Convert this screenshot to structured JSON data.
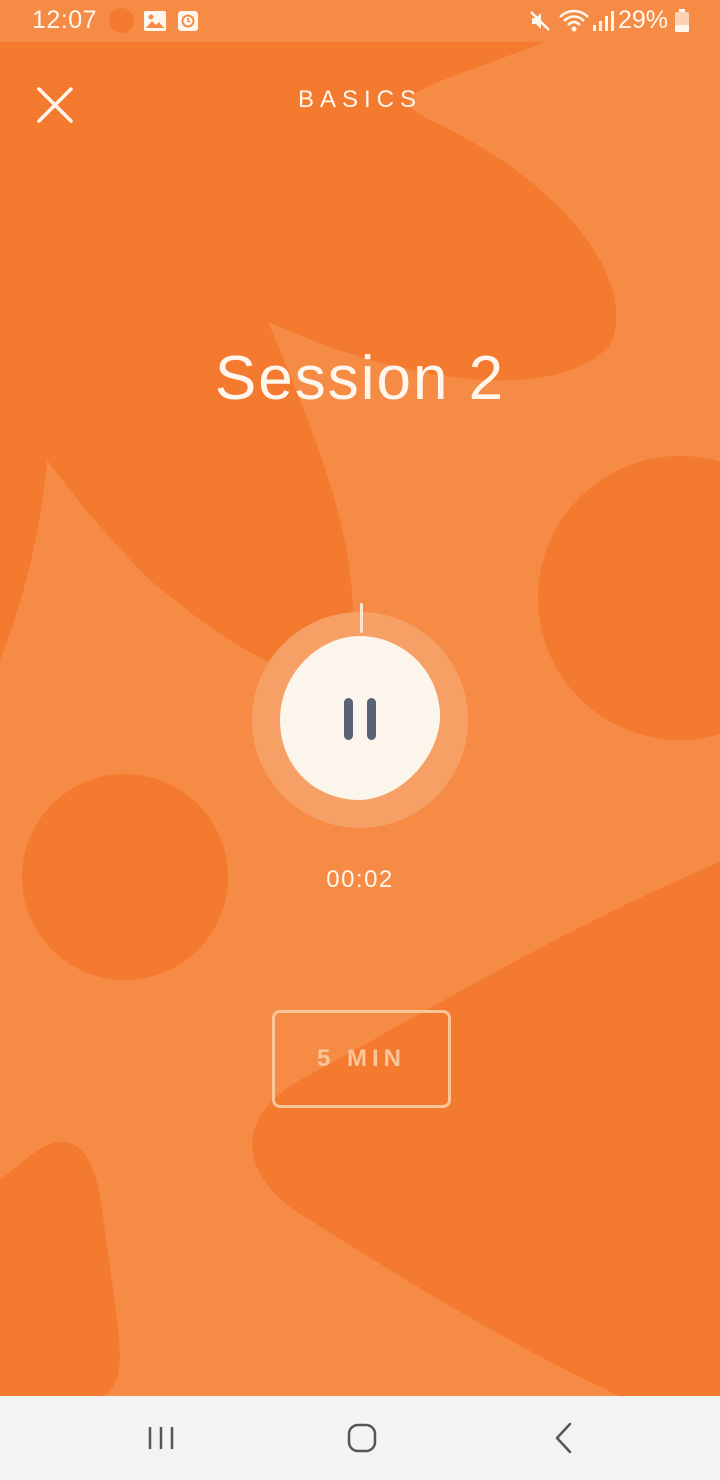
{
  "status_bar": {
    "time": "12:07",
    "battery": "29%",
    "icons": [
      "notification-dot-icon",
      "image-icon",
      "clock-app-icon",
      "mute-icon",
      "wifi-icon",
      "signal-icon",
      "battery-icon"
    ]
  },
  "header": {
    "title": "BASICS",
    "close_icon": "close-icon"
  },
  "session": {
    "title": "Session 2"
  },
  "player": {
    "state": "playing",
    "control_icon": "pause-icon",
    "elapsed": "00:02"
  },
  "duration": {
    "label": "5 MIN"
  },
  "nav_bar": {
    "icons": [
      "recent-apps-icon",
      "home-icon",
      "back-icon"
    ]
  },
  "colors": {
    "background": "#f58b45",
    "shape": "#f47a2f",
    "text": "#fff7ee",
    "button_fill": "#fcf5ec",
    "pause_glyph": "#5a6178",
    "outline": "#fbc59a",
    "nav_bar": "#f3f3f3"
  }
}
